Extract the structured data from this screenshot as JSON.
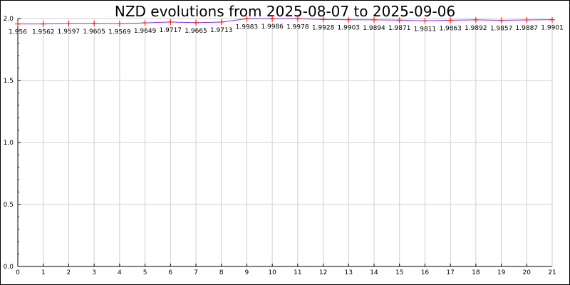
{
  "chart_data": {
    "type": "line",
    "title": "NZD evolutions from 2025-08-07 to 2025-09-06",
    "xlabel": "",
    "ylabel": "",
    "x": [
      0,
      1,
      2,
      3,
      4,
      5,
      6,
      7,
      8,
      9,
      10,
      11,
      12,
      13,
      14,
      15,
      16,
      17,
      18,
      19,
      20,
      21
    ],
    "xlim": [
      0,
      21
    ],
    "ylim": [
      0,
      2.0
    ],
    "y_ticks": [
      0.0,
      0.5,
      1.0,
      1.5,
      2.0
    ],
    "y_tick_labels": [
      "0.0",
      "0.5",
      "1.0",
      "1.5",
      "2.0"
    ],
    "grid": true,
    "series": [
      {
        "values": [
          1.956,
          1.9562,
          1.9597,
          1.9605,
          1.9569,
          1.9649,
          1.9717,
          1.9665,
          1.9713,
          1.9983,
          1.9986,
          1.9978,
          1.9928,
          1.9903,
          1.9894,
          1.9871,
          1.9811,
          1.9863,
          1.9892,
          1.9857,
          1.9887,
          1.9901
        ],
        "labels": [
          "1.956",
          "1.9562",
          "1.9597",
          "1.9605",
          "1.9569",
          "1.9649",
          "1.9717",
          "1.9665",
          "1.9713",
          "1.9983",
          "1.9986",
          "1.9978",
          "1.9928",
          "1.9903",
          "1.9894",
          "1.9871",
          "1.9811",
          "1.9863",
          "1.9892",
          "1.9857",
          "1.9887",
          "1.9901"
        ],
        "line_color": "#8a2be2",
        "marker_color": "#ff0000"
      }
    ]
  }
}
